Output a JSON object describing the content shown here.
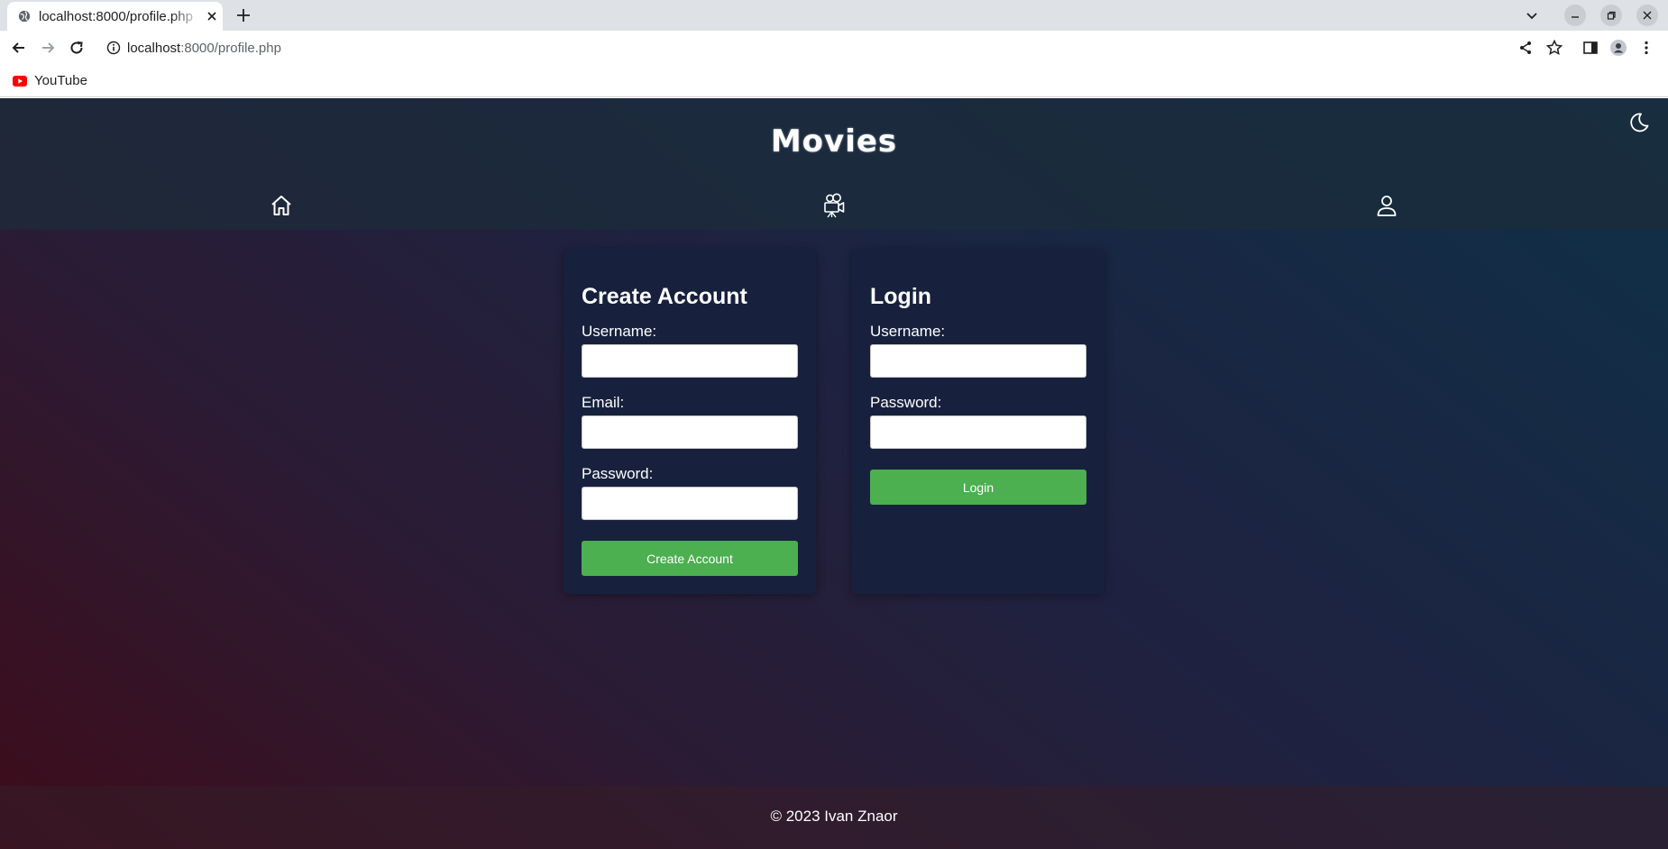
{
  "browser": {
    "tab": {
      "title": "localhost:8000/profile.php",
      "favicon": "globe-icon"
    },
    "address": {
      "host": "localhost",
      "rest": ":8000/profile.php"
    },
    "bookmarks": [
      {
        "label": "YouTube",
        "icon": "youtube-icon"
      }
    ]
  },
  "site": {
    "title": "Movies",
    "nav": [
      {
        "name": "home",
        "icon": "home-icon"
      },
      {
        "name": "movies",
        "icon": "movie-camera-icon"
      },
      {
        "name": "profile",
        "icon": "user-icon"
      }
    ],
    "theme_toggle_icon": "moon-icon"
  },
  "create_account": {
    "title": "Create Account",
    "username_label": "Username:",
    "username_value": "",
    "email_label": "Email:",
    "email_value": "",
    "password_label": "Password:",
    "password_value": "",
    "button_label": "Create Account"
  },
  "login": {
    "title": "Login",
    "username_label": "Username:",
    "username_value": "",
    "password_label": "Password:",
    "password_value": "",
    "button_label": "Login"
  },
  "footer": {
    "text": "© 2023 Ivan Znaor"
  },
  "colors": {
    "accent_button": "#4caf50",
    "card_bg": "#17213d"
  }
}
